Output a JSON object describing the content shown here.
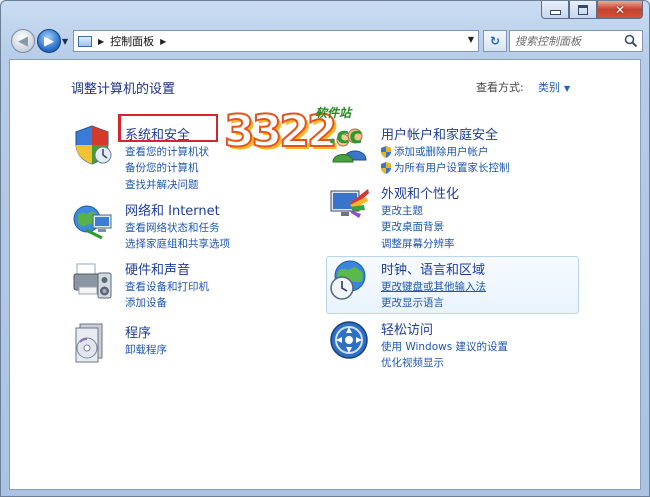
{
  "window": {
    "controls": [
      "minimize",
      "maximize",
      "close"
    ],
    "close_glyph": "✕"
  },
  "nav": {
    "back_glyph": "◀",
    "forward_glyph": "▶",
    "dropdown_glyph": "▼",
    "breadcrumb_sep": "▶",
    "breadcrumb": [
      "控制面板"
    ],
    "address_dropdown_glyph": "▼",
    "refresh_glyph": "↻",
    "search_placeholder": "搜索控制面板"
  },
  "content": {
    "title": "调整计算机的设置",
    "view_by_label": "查看方式:",
    "view_by_value": "类别",
    "view_by_glyph": "▼"
  },
  "categories": [
    {
      "heading": "系统和安全",
      "icon": "shield-check-icon",
      "links": [
        "查看您的计算机状",
        "备份您的计算机",
        "查找并解决问题"
      ]
    },
    {
      "heading": "网络和 Internet",
      "icon": "network-globe-icon",
      "links": [
        "查看网络状态和任务",
        "选择家庭组和共享选项"
      ]
    },
    {
      "heading": "硬件和声音",
      "icon": "printer-speaker-icon",
      "links": [
        "查看设备和打印机",
        "添加设备"
      ]
    },
    {
      "heading": "程序",
      "icon": "programs-disc-icon",
      "links": [
        "卸载程序"
      ]
    },
    {
      "heading": "用户帐户和家庭安全",
      "icon": "users-icon",
      "links": [
        "添加或删除用户帐户",
        "为所有用户设置家长控制"
      ]
    },
    {
      "heading": "外观和个性化",
      "icon": "appearance-paint-icon",
      "links": [
        "更改主题",
        "更改桌面背景",
        "调整屏幕分辨率"
      ]
    },
    {
      "heading": "时钟、语言和区域",
      "icon": "clock-globe-icon",
      "links": [
        "更改键盘或其他输入法",
        "更改显示语言"
      ]
    },
    {
      "heading": "轻松访问",
      "icon": "ease-of-access-icon",
      "links": [
        "使用 Windows 建议的设置",
        "优化视频显示"
      ]
    }
  ],
  "watermark": {
    "number": "3322",
    "domain": ".cc",
    "tagline": "软件站"
  },
  "colors": {
    "link": "#1e57b0",
    "heading": "#1e3d99",
    "highlight_border": "#d3262e"
  }
}
